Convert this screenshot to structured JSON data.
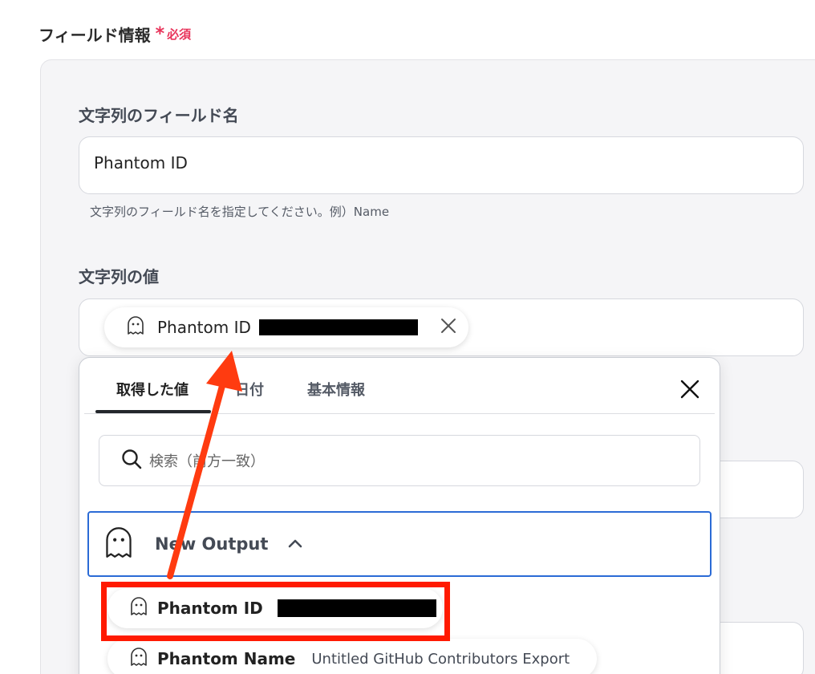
{
  "section": {
    "title": "フィールド情報",
    "required": "必須",
    "required_mark": "*"
  },
  "field_name": {
    "label": "文字列のフィールド名",
    "value": "Phantom ID",
    "hint": "文字列のフィールド名を指定してください。例）Name"
  },
  "field_value": {
    "label": "文字列の値",
    "chip_label": "Phantom ID"
  },
  "popup": {
    "tabs": [
      {
        "label": "取得した値",
        "active": true
      },
      {
        "label": "日付",
        "active": false
      },
      {
        "label": "基本情報",
        "active": false
      }
    ],
    "search_placeholder": "検索（前方一致）",
    "group": {
      "label": "New Output",
      "expanded": true
    },
    "items": [
      {
        "label": "Phantom ID",
        "value": ""
      },
      {
        "label": "Phantom Name",
        "value": "Untitled GitHub Contributors Export"
      }
    ]
  },
  "colors": {
    "required": "#e8335a",
    "selected_border": "#2b6bd6",
    "highlight": "#ff1a00",
    "arrow": "#ff3b10"
  },
  "icons": [
    "ghost-icon",
    "close-icon",
    "search-icon",
    "chevron-up-icon"
  ]
}
